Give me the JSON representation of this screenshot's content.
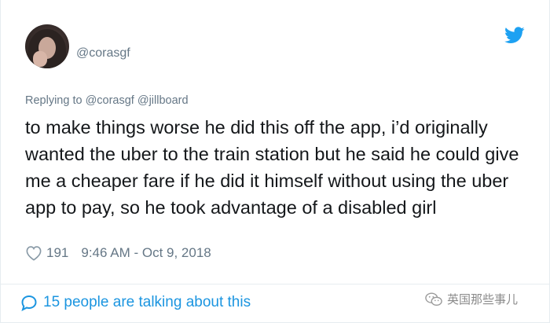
{
  "user": {
    "handle": "@corasgf",
    "avatar_icon": "profile-photo"
  },
  "reply": {
    "text": "Replying to @corasgf @jillboard"
  },
  "tweet": {
    "text": "to make things worse he did this off the app, i’d originally wanted the uber to the train station but he said he could give me a cheaper fare if he did it himself without using the uber app to pay, so he took advantage of a disabled girl"
  },
  "meta": {
    "likes": "191",
    "timestamp": "9:46 AM - Oct 9, 2018"
  },
  "footer": {
    "talking": "15 people are talking about this"
  },
  "watermark": {
    "text": "英国那些事儿"
  },
  "colors": {
    "twitter_blue": "#1da1f2",
    "link_blue": "#1b95e0",
    "secondary_text": "#657786",
    "primary_text": "#14171a"
  }
}
